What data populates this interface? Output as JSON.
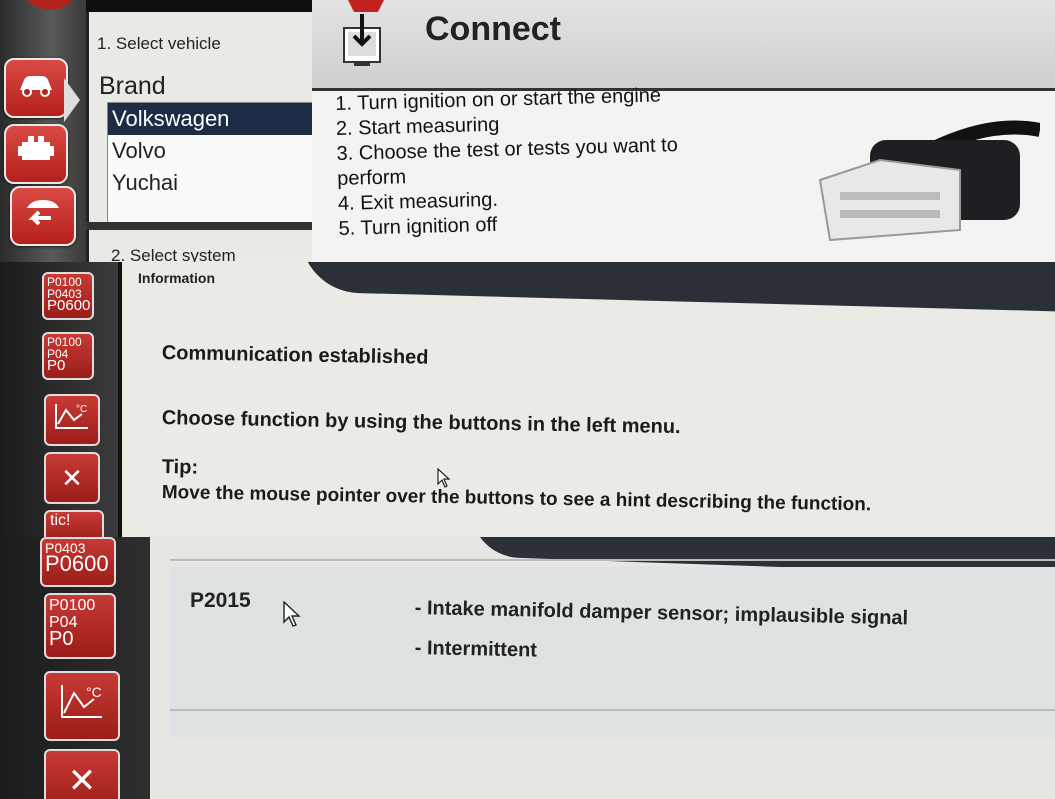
{
  "panel1": {
    "step_label": "1. Select vehicle",
    "brand_label": "Brand",
    "brands": [
      "Volkswagen",
      "Volvo",
      "Yuchai"
    ],
    "selected_brand": "Volkswagen",
    "step2_label": "2. Select system",
    "connect_title": "Connect",
    "instructions": [
      "1. Turn ignition on or start the engine",
      "2. Start measuring",
      "3. Choose the test or tests you want to",
      "perform",
      "4. Exit measuring.",
      "5. Turn ignition off"
    ]
  },
  "panel2": {
    "info_label": "Information",
    "dtc_icon_lines": [
      "P0100",
      "P0403",
      "P0600"
    ],
    "dtc_icon2_lines": [
      "P0100",
      "P04",
      "P0"
    ],
    "status_text": "Communication established",
    "instruction_text": "Choose function by using the buttons in the left menu.",
    "tip_label": "Tip:",
    "tip_text": "Move the mouse pointer over the buttons to see a hint describing the function.",
    "partial_button_text": "tic!"
  },
  "panel3": {
    "dtc_icon_text": "P0600",
    "dtc_icon_top_text": "P0403",
    "dtc_icon2_lines": [
      "P0100",
      "P04",
      "P0"
    ],
    "fault_code": "P2015",
    "fault_desc_1": "- Intake manifold damper sensor; implausible signal",
    "fault_desc_2": "- Intermittent"
  },
  "icons": [
    "car-icon",
    "engine-icon",
    "back-icon",
    "dtc-icon",
    "temperature-graph-icon",
    "tools-icon",
    "cursor-icon",
    "obd-connector-icon",
    "connect-icon"
  ]
}
